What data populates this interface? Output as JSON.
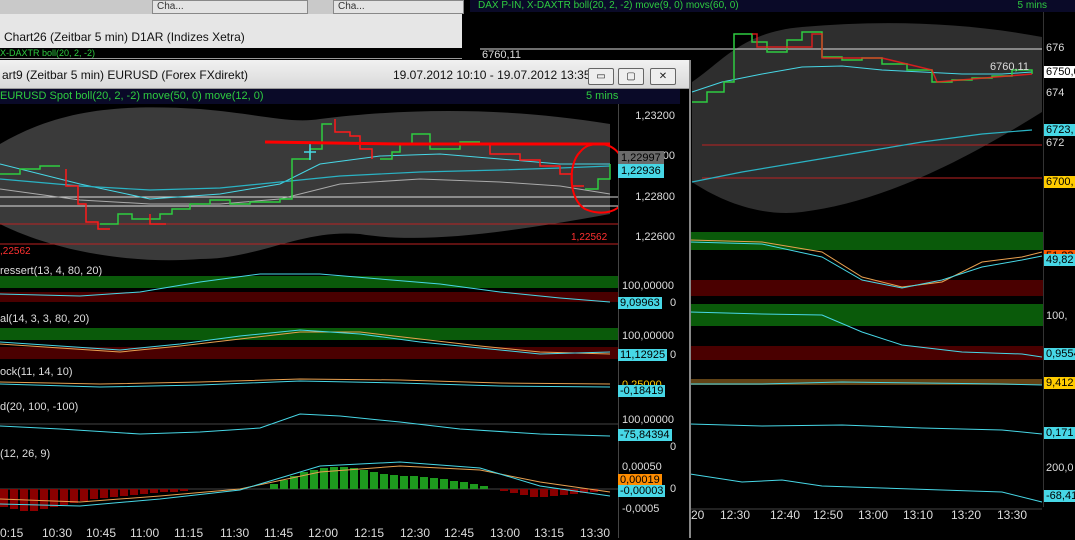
{
  "taskbar": {
    "items": [
      "Cha...",
      "Cha..."
    ]
  },
  "chart26": {
    "title": "Chart26 (Zeitbar 5 min)  D1AR (Indizes Xetra)",
    "indicator": "X-DAXTR boll(20, 2, -2)"
  },
  "bg_chart": {
    "title": "DAX P-IN, X-DAXTR boll(20, 2, -2) move(9, 0) movs(60, 0)",
    "interval": "5 mins",
    "level_left": "6760,11",
    "level_right": "6760,11",
    "axis_labels": [
      "676",
      "6750,0",
      "674",
      "672",
      "6723,",
      "6700,"
    ],
    "panel_values": [
      "51,23",
      "49,82",
      "100,",
      "0,9554",
      "9,412",
      "0,171",
      "200,0",
      "-68,41"
    ],
    "time_labels": [
      "20",
      "12:30",
      "12:40",
      "12:50",
      "13:00",
      "13:10",
      "13:20",
      "13:30"
    ]
  },
  "window": {
    "title": "art9 (Zeitbar 5 min)  EURUSD (Forex FXdirekt)",
    "date_range": "19.07.2012 10:10 - 19.07.2012 13:35",
    "min_btn": "▭",
    "restore_btn": "▢",
    "close_btn": "✕"
  },
  "main_chart": {
    "indicator_label": "EURUSD Spot  boll(20, 2, -2)  move(50, 0)  move(12, 0)",
    "interval": "5 mins",
    "left_level": ",22562",
    "right_level": "1,22562",
    "axis_labels": [
      "1,23200",
      "1,23000",
      "1,22800",
      "1,22600"
    ],
    "price_upper": "1,22997",
    "price_current": "1,22936"
  },
  "panels": [
    {
      "label": "ressert(13, 4, 80, 20)",
      "axis_top": "100,00000",
      "value": "9,09963",
      "axis_zero": "0"
    },
    {
      "label": "al(14, 3, 3, 80, 20)",
      "axis_top": "100,00000",
      "value": "11,12925",
      "axis_zero": "0"
    },
    {
      "label": "ock(11, 14, 10)",
      "axis_top": "0,25000",
      "value": "-0,18419"
    },
    {
      "label": "d(20, 100, -100)",
      "axis_top": "100,00000",
      "value": "-75,84394",
      "axis_zero": "0"
    },
    {
      "label": "(12, 26, 9)",
      "axis_top": "0,00050",
      "value": "0,00019",
      "value2": "-0,00003",
      "axis_zero": "0",
      "axis_bottom": "-0,0005"
    }
  ],
  "time_axis": [
    "0:15",
    "10:30",
    "10:45",
    "11:00",
    "11:15",
    "11:30",
    "11:45",
    "12:00",
    "12:15",
    "12:30",
    "12:45",
    "13:00",
    "13:15",
    "13:30"
  ],
  "colors": {
    "up": "#2ecc40",
    "down": "#ff1a1a",
    "accent_cyan": "#47d7e6",
    "panel_green": "#0a5a0a",
    "panel_red": "#4a0000"
  }
}
